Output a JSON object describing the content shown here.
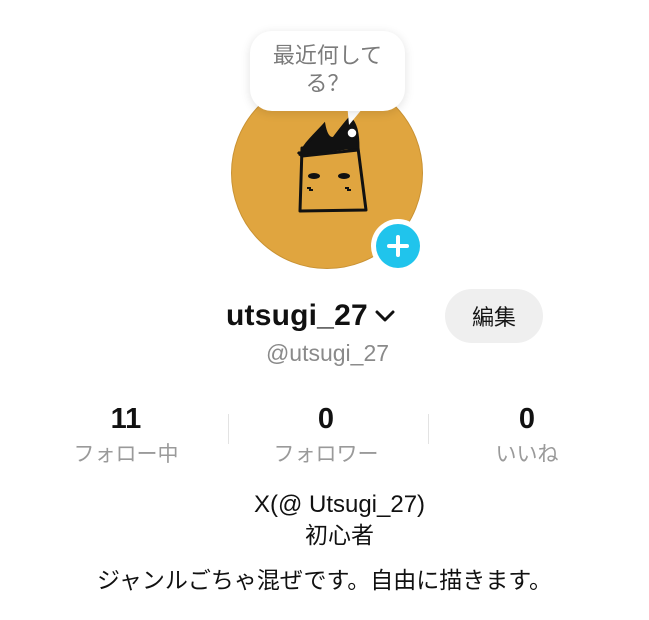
{
  "profile": {
    "status_prompt": "最近何してる？",
    "username": "utsugi_27",
    "handle": "@utsugi_27",
    "edit_label": "編集",
    "avatar_bg_color": "#e0a53f",
    "add_button_color": "#20c4ec"
  },
  "stats": [
    {
      "value": "11",
      "label": "フォロー中"
    },
    {
      "value": "0",
      "label": "フォロワー"
    },
    {
      "value": "0",
      "label": "いいね"
    }
  ],
  "bio": {
    "line1": "X(@ Utsugi_27)",
    "line2": "初心者",
    "line3": "ジャンルごちゃ混ぜです。自由に描きます。"
  },
  "icons": {
    "add": "plus-icon",
    "switch_account": "chevron-down-icon",
    "avatar_art": "doodle-character"
  }
}
